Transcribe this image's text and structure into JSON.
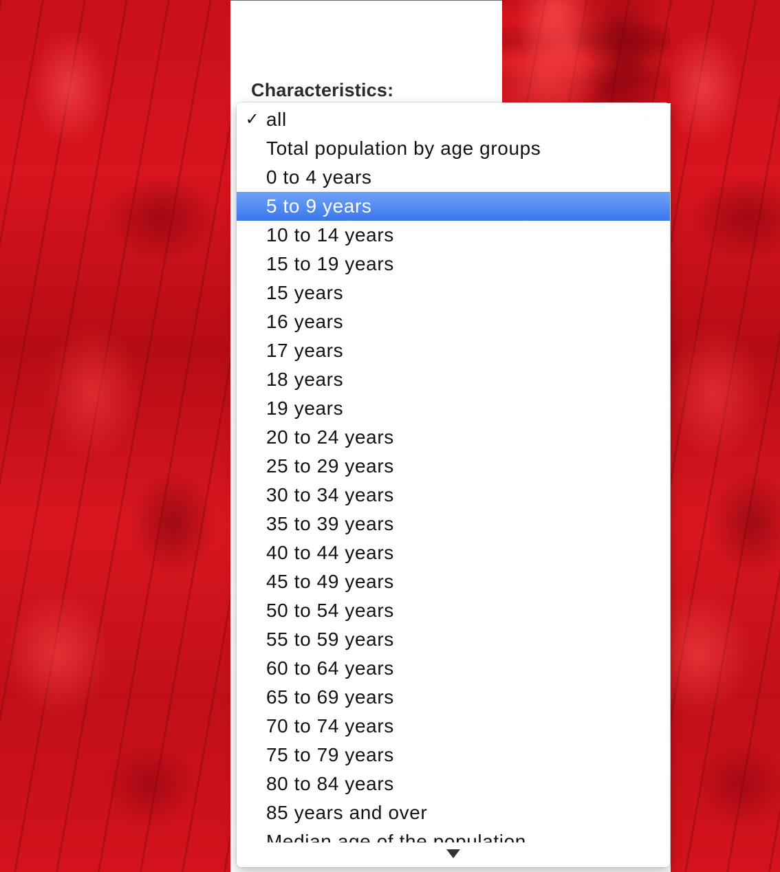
{
  "colors": {
    "selection": "#3b78ee",
    "leaf_red": "#c8101a",
    "label": "#2b2b2b"
  },
  "field": {
    "label": "Characteristics:"
  },
  "dropdown": {
    "checked_option": "all",
    "highlighted_option": "5 to 9 years",
    "check_glyph": "✓",
    "scroll_indicator_icon": "scroll-down-arrow-icon",
    "options": [
      "all",
      "Total population by age groups",
      "0 to 4 years",
      "5 to 9 years",
      "10 to 14 years",
      "15 to 19 years",
      "15 years",
      "16 years",
      "17 years",
      "18 years",
      "19 years",
      "20 to 24 years",
      "25 to 29 years",
      "30 to 34 years",
      "35 to 39 years",
      "40 to 44 years",
      "45 to 49 years",
      "50 to 54 years",
      "55 to 59 years",
      "60 to 64 years",
      "65 to 69 years",
      "70 to 74 years",
      "75 to 79 years",
      "80 to 84 years",
      "85 years and over",
      "Median age of the population"
    ]
  }
}
